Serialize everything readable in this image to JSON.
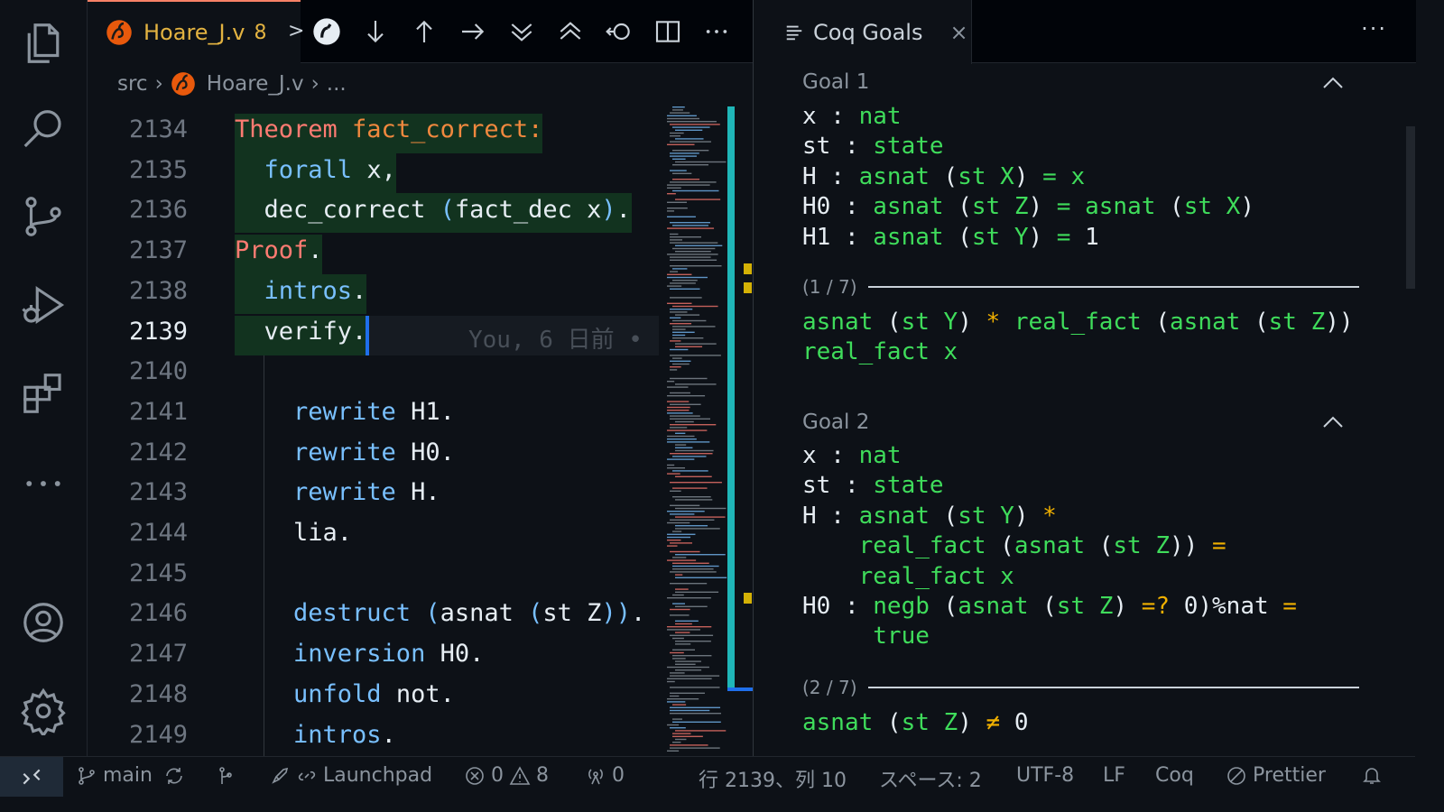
{
  "editor": {
    "tab": {
      "filename": "Hoare_J.v",
      "problem_count": "8",
      "arrow": ">"
    },
    "breadcrumb": {
      "folder": "src",
      "file": "Hoare_J.v",
      "rest": "..."
    },
    "blame": "You, 6 日前 •",
    "lines": [
      {
        "n": "2134",
        "tokens": [
          [
            "kw",
            "Theorem "
          ],
          [
            "fn",
            "fact_correct:"
          ]
        ]
      },
      {
        "n": "2135",
        "tokens": [
          [
            "tac",
            "  forall "
          ],
          [
            "plain",
            "x,"
          ]
        ]
      },
      {
        "n": "2136",
        "tokens": [
          [
            "plain",
            "  dec_correct "
          ],
          [
            "par",
            "("
          ],
          [
            "plain",
            "fact_dec x"
          ],
          [
            "par",
            ")"
          ],
          [
            "plain",
            "."
          ]
        ]
      },
      {
        "n": "2137",
        "tokens": [
          [
            "kw",
            "Proof"
          ],
          [
            "plain",
            "."
          ]
        ]
      },
      {
        "n": "2138",
        "tokens": [
          [
            "tac",
            "  intros"
          ],
          [
            "plain",
            "."
          ]
        ]
      },
      {
        "n": "2139",
        "tokens": [
          [
            "plain",
            "  verify."
          ]
        ]
      },
      {
        "n": "2140",
        "tokens": []
      },
      {
        "n": "2141",
        "tokens": [
          [
            "tac",
            "    rewrite "
          ],
          [
            "plain",
            "H1."
          ]
        ]
      },
      {
        "n": "2142",
        "tokens": [
          [
            "tac",
            "    rewrite "
          ],
          [
            "plain",
            "H0."
          ]
        ]
      },
      {
        "n": "2143",
        "tokens": [
          [
            "tac",
            "    rewrite "
          ],
          [
            "plain",
            "H."
          ]
        ]
      },
      {
        "n": "2144",
        "tokens": [
          [
            "plain",
            "    lia."
          ]
        ]
      },
      {
        "n": "2145",
        "tokens": []
      },
      {
        "n": "2146",
        "tokens": [
          [
            "tac",
            "    destruct "
          ],
          [
            "par",
            "("
          ],
          [
            "plain",
            "asnat "
          ],
          [
            "par",
            "("
          ],
          [
            "plain",
            "st Z"
          ],
          [
            "par",
            "))"
          ],
          [
            "plain",
            "."
          ]
        ]
      },
      {
        "n": "2147",
        "tokens": [
          [
            "tac",
            "    inversion "
          ],
          [
            "plain",
            "H0."
          ]
        ]
      },
      {
        "n": "2148",
        "tokens": [
          [
            "tac",
            "    unfold "
          ],
          [
            "plain",
            "not."
          ]
        ]
      },
      {
        "n": "2149",
        "tokens": [
          [
            "tac",
            "    intros"
          ],
          [
            "plain",
            "."
          ]
        ]
      }
    ]
  },
  "panel": {
    "tab_label": "Coq Goals",
    "close": "×",
    "more": "···",
    "goal1": {
      "title": "Goal 1",
      "hyps": [
        [
          [
            "plain",
            "x : "
          ],
          [
            "g",
            "nat"
          ]
        ],
        [
          [
            "plain",
            "st : "
          ],
          [
            "g",
            "state"
          ]
        ],
        [
          [
            "plain",
            "H : "
          ],
          [
            "g",
            "asnat "
          ],
          [
            "plain",
            "("
          ],
          [
            "g",
            "st X"
          ],
          [
            "plain",
            ") "
          ],
          [
            "g",
            "="
          ],
          [
            "plain",
            " "
          ],
          [
            "g",
            "x"
          ]
        ],
        [
          [
            "plain",
            "H0 : "
          ],
          [
            "g",
            "asnat "
          ],
          [
            "plain",
            "("
          ],
          [
            "g",
            "st Z"
          ],
          [
            "plain",
            ") "
          ],
          [
            "g",
            "="
          ],
          [
            "plain",
            " "
          ],
          [
            "g",
            "asnat "
          ],
          [
            "plain",
            "("
          ],
          [
            "g",
            "st X"
          ],
          [
            "plain",
            ")"
          ]
        ],
        [
          [
            "plain",
            "H1 : "
          ],
          [
            "g",
            "asnat "
          ],
          [
            "plain",
            "("
          ],
          [
            "g",
            "st Y"
          ],
          [
            "plain",
            ") "
          ],
          [
            "g",
            "="
          ],
          [
            "plain",
            " 1"
          ]
        ]
      ],
      "counter": "(1 / 7)",
      "concl": [
        [
          [
            "g",
            "asnat "
          ],
          [
            "plain",
            "("
          ],
          [
            "g",
            "st Y"
          ],
          [
            "plain",
            ") "
          ],
          [
            "o",
            "*"
          ],
          [
            "plain",
            " "
          ],
          [
            "g",
            "real_fact "
          ],
          [
            "plain",
            "("
          ],
          [
            "g",
            "asnat "
          ],
          [
            "plain",
            "("
          ],
          [
            "g",
            "st Z"
          ],
          [
            "plain",
            ")"
          ],
          [
            "plain",
            ")"
          ]
        ],
        [
          [
            "g",
            "real_fact x"
          ]
        ]
      ]
    },
    "goal2": {
      "title": "Goal 2",
      "hyps": [
        [
          [
            "plain",
            "x : "
          ],
          [
            "g",
            "nat"
          ]
        ],
        [
          [
            "plain",
            "st : "
          ],
          [
            "g",
            "state"
          ]
        ],
        [
          [
            "plain",
            "H : "
          ],
          [
            "g",
            "asnat "
          ],
          [
            "plain",
            "("
          ],
          [
            "g",
            "st Y"
          ],
          [
            "plain",
            ") "
          ],
          [
            "o",
            "*"
          ]
        ],
        [
          [
            "plain",
            "    "
          ],
          [
            "g",
            "real_fact "
          ],
          [
            "plain",
            "("
          ],
          [
            "g",
            "asnat "
          ],
          [
            "plain",
            "("
          ],
          [
            "g",
            "st Z"
          ],
          [
            "plain",
            ")) "
          ],
          [
            "o",
            "="
          ]
        ],
        [
          [
            "plain",
            "    "
          ],
          [
            "g",
            "real_fact x"
          ]
        ],
        [
          [
            "plain",
            "H0 : "
          ],
          [
            "g",
            "negb "
          ],
          [
            "plain",
            "("
          ],
          [
            "g",
            "asnat "
          ],
          [
            "plain",
            "("
          ],
          [
            "g",
            "st Z"
          ],
          [
            "plain",
            ") "
          ],
          [
            "o",
            "=?"
          ],
          [
            "plain",
            " 0)%nat "
          ],
          [
            "o",
            "="
          ]
        ],
        [
          [
            "plain",
            "     "
          ],
          [
            "g",
            "true"
          ]
        ]
      ],
      "counter": "(2 / 7)",
      "concl": [
        [
          [
            "g",
            "asnat "
          ],
          [
            "plain",
            "("
          ],
          [
            "g",
            "st Z"
          ],
          [
            "plain",
            ") "
          ],
          [
            "o",
            "≠"
          ],
          [
            "plain",
            " 0"
          ]
        ]
      ]
    }
  },
  "status": {
    "branch": "main",
    "launchpad": "Launchpad",
    "errors": "0",
    "warnings": "8",
    "ports": "0",
    "position": "行 2139、列 10",
    "spaces": "スペース: 2",
    "encoding": "UTF-8",
    "eol": "LF",
    "language": "Coq",
    "formatter": "Prettier"
  },
  "colors": {
    "accent": "#1f6feb",
    "term": "#3fdc5b",
    "operator": "#f0b000",
    "keyword": "#ff7b72"
  }
}
